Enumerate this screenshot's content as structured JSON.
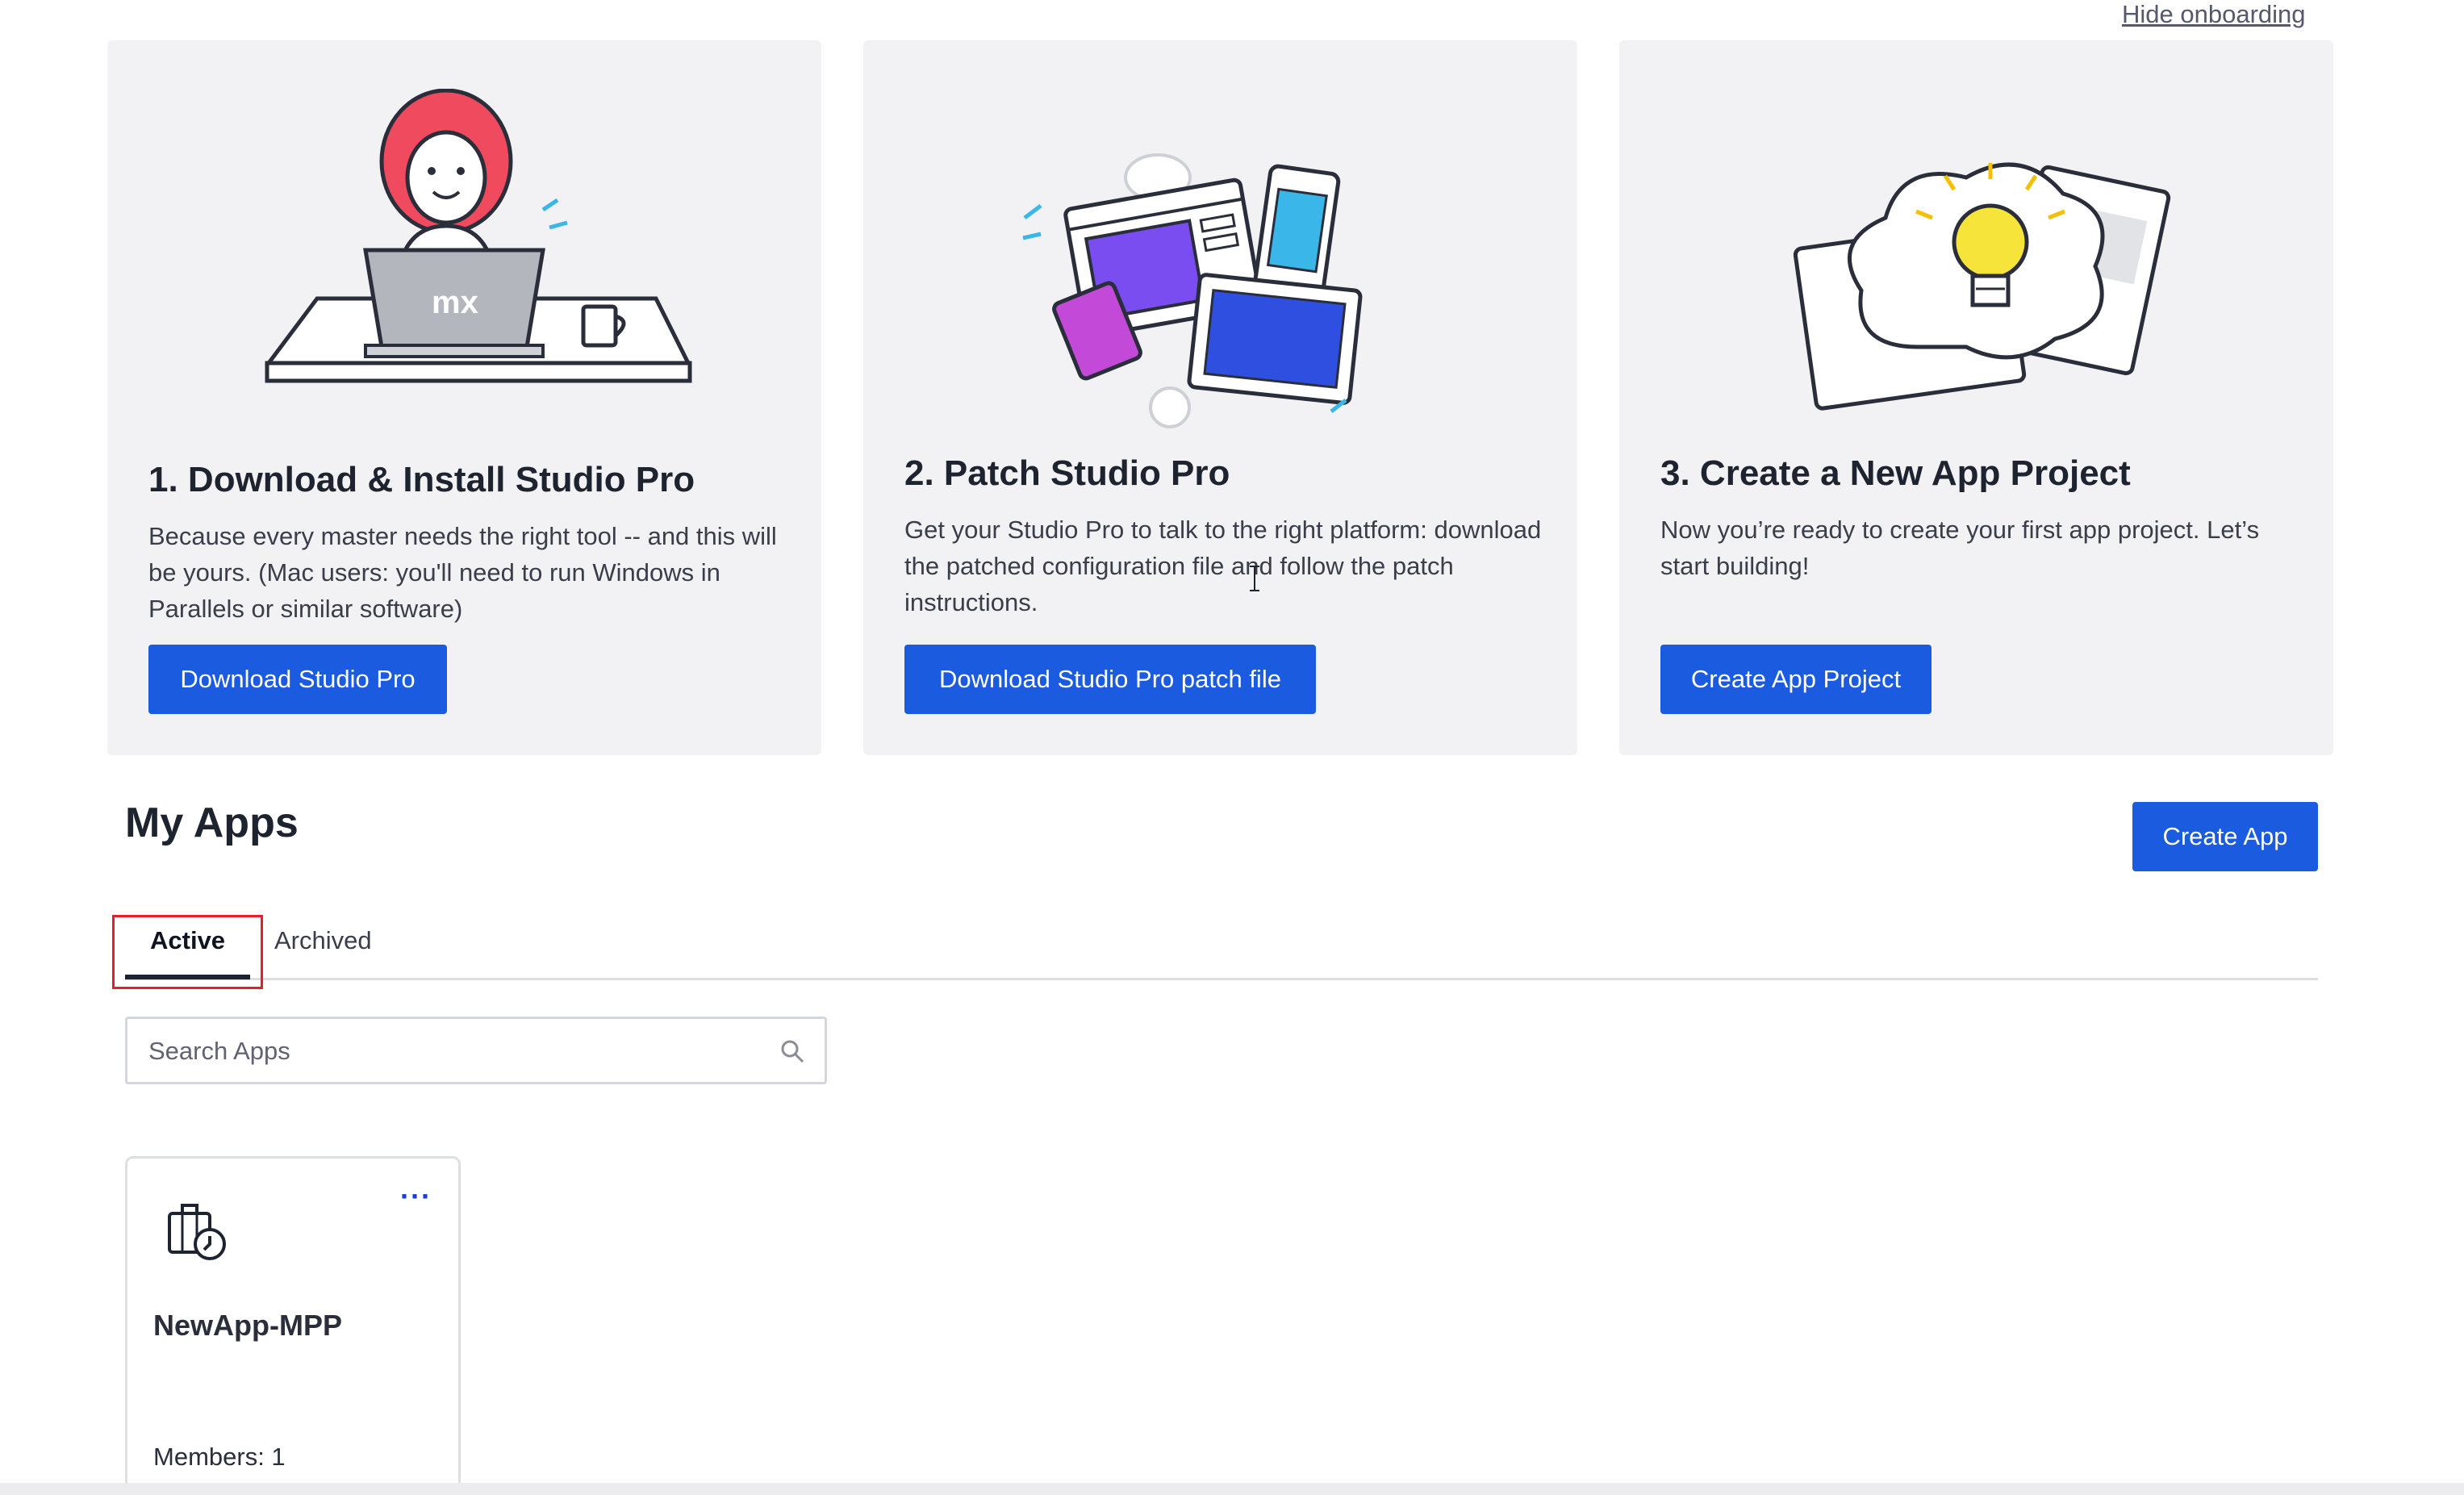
{
  "header": {
    "hide_onboarding": "Hide onboarding"
  },
  "onboarding": {
    "cards": [
      {
        "title": "1. Download & Install Studio Pro",
        "description": "Because every master needs the right tool -- and this will be yours. (Mac users: you'll need to run Windows in Parallels or similar software)",
        "button": "Download Studio Pro",
        "illustration": "person-at-laptop-illustration",
        "laptop_logo": "mx"
      },
      {
        "title": "2. Patch Studio Pro",
        "description": "Get your Studio Pro to talk to the right platform: download the patched configuration file and follow the patch instructions.",
        "button": "Download Studio Pro patch file",
        "illustration": "devices-illustration"
      },
      {
        "title": "3. Create a New App Project",
        "description": "Now you’re ready to create your first app project. Let’s start building!",
        "button": "Create App Project",
        "illustration": "lightbulb-idea-illustration"
      }
    ]
  },
  "my_apps": {
    "title": "My Apps",
    "create_button": "Create App",
    "tabs": [
      {
        "label": "Active",
        "selected": true
      },
      {
        "label": "Archived",
        "selected": false
      }
    ],
    "search": {
      "placeholder": "Search Apps",
      "value": ""
    },
    "apps": [
      {
        "name": "NewApp-MPP",
        "members": "Members: 1",
        "more": "···",
        "icon": "briefcase-clock-icon"
      }
    ]
  },
  "colors": {
    "accent": "#1a5be0",
    "card_bg": "#f2f2f4",
    "highlight": "#e0202a"
  }
}
